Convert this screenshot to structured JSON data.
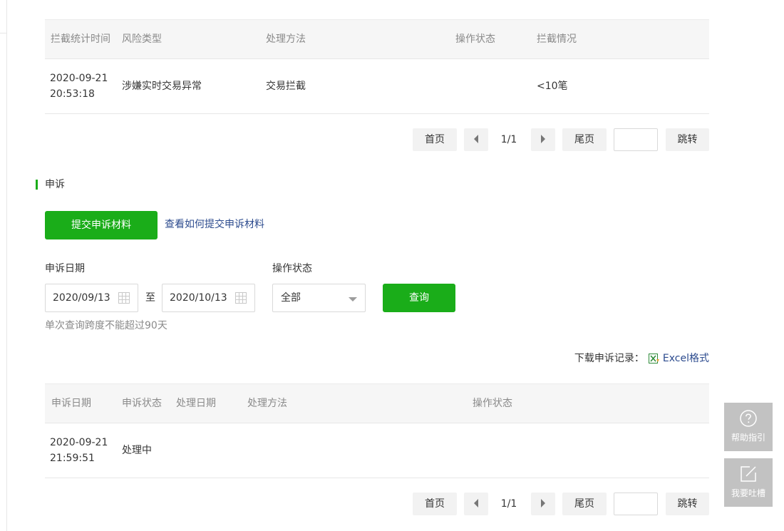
{
  "interception_table": {
    "headers": [
      "拦截统计时间",
      "风险类型",
      "处理方法",
      "操作状态",
      "拦截情况"
    ],
    "rows": [
      {
        "time_date": "2020-09-21",
        "time_clock": "20:53:18",
        "risk_type": "涉嫌实时交易异常",
        "method": "交易拦截",
        "status": "",
        "result": "<10笔"
      }
    ]
  },
  "pager_top": {
    "first": "首页",
    "page": "1/1",
    "last": "尾页",
    "jump_value": "",
    "jump": "跳转"
  },
  "appeal": {
    "section_title": "申诉",
    "submit_button": "提交申诉材料",
    "how_link": "查看如何提交申诉材料",
    "date_label": "申诉日期",
    "date_from": "2020/09/13",
    "date_sep": "至",
    "date_to": "2020/10/13",
    "status_label": "操作状态",
    "status_selected": "全部",
    "query_button": "查询",
    "hint": "单次查询跨度不能超过90天",
    "download_label": "下载申诉记录：",
    "download_link": "Excel格式"
  },
  "appeal_table": {
    "headers": [
      "申诉日期",
      "申诉状态",
      "处理日期",
      "处理方法",
      "操作状态"
    ],
    "rows": [
      {
        "date_date": "2020-09-21",
        "date_clock": "21:59:51",
        "appeal_status": "处理中",
        "handle_date": "",
        "method": "",
        "status": ""
      }
    ]
  },
  "pager_bottom": {
    "first": "首页",
    "page": "1/1",
    "last": "尾页",
    "jump_value": "",
    "jump": "跳转"
  },
  "floating": {
    "help": {
      "label": "帮助指引",
      "icon": "question-circle-icon"
    },
    "feedback": {
      "label": "我要吐槽",
      "icon": "edit-icon"
    }
  },
  "colors": {
    "accent_green": "#1aad19",
    "link_blue": "#2c4b8e",
    "muted_text": "#8a8a8a",
    "float_bg": "#c2c2c2"
  }
}
